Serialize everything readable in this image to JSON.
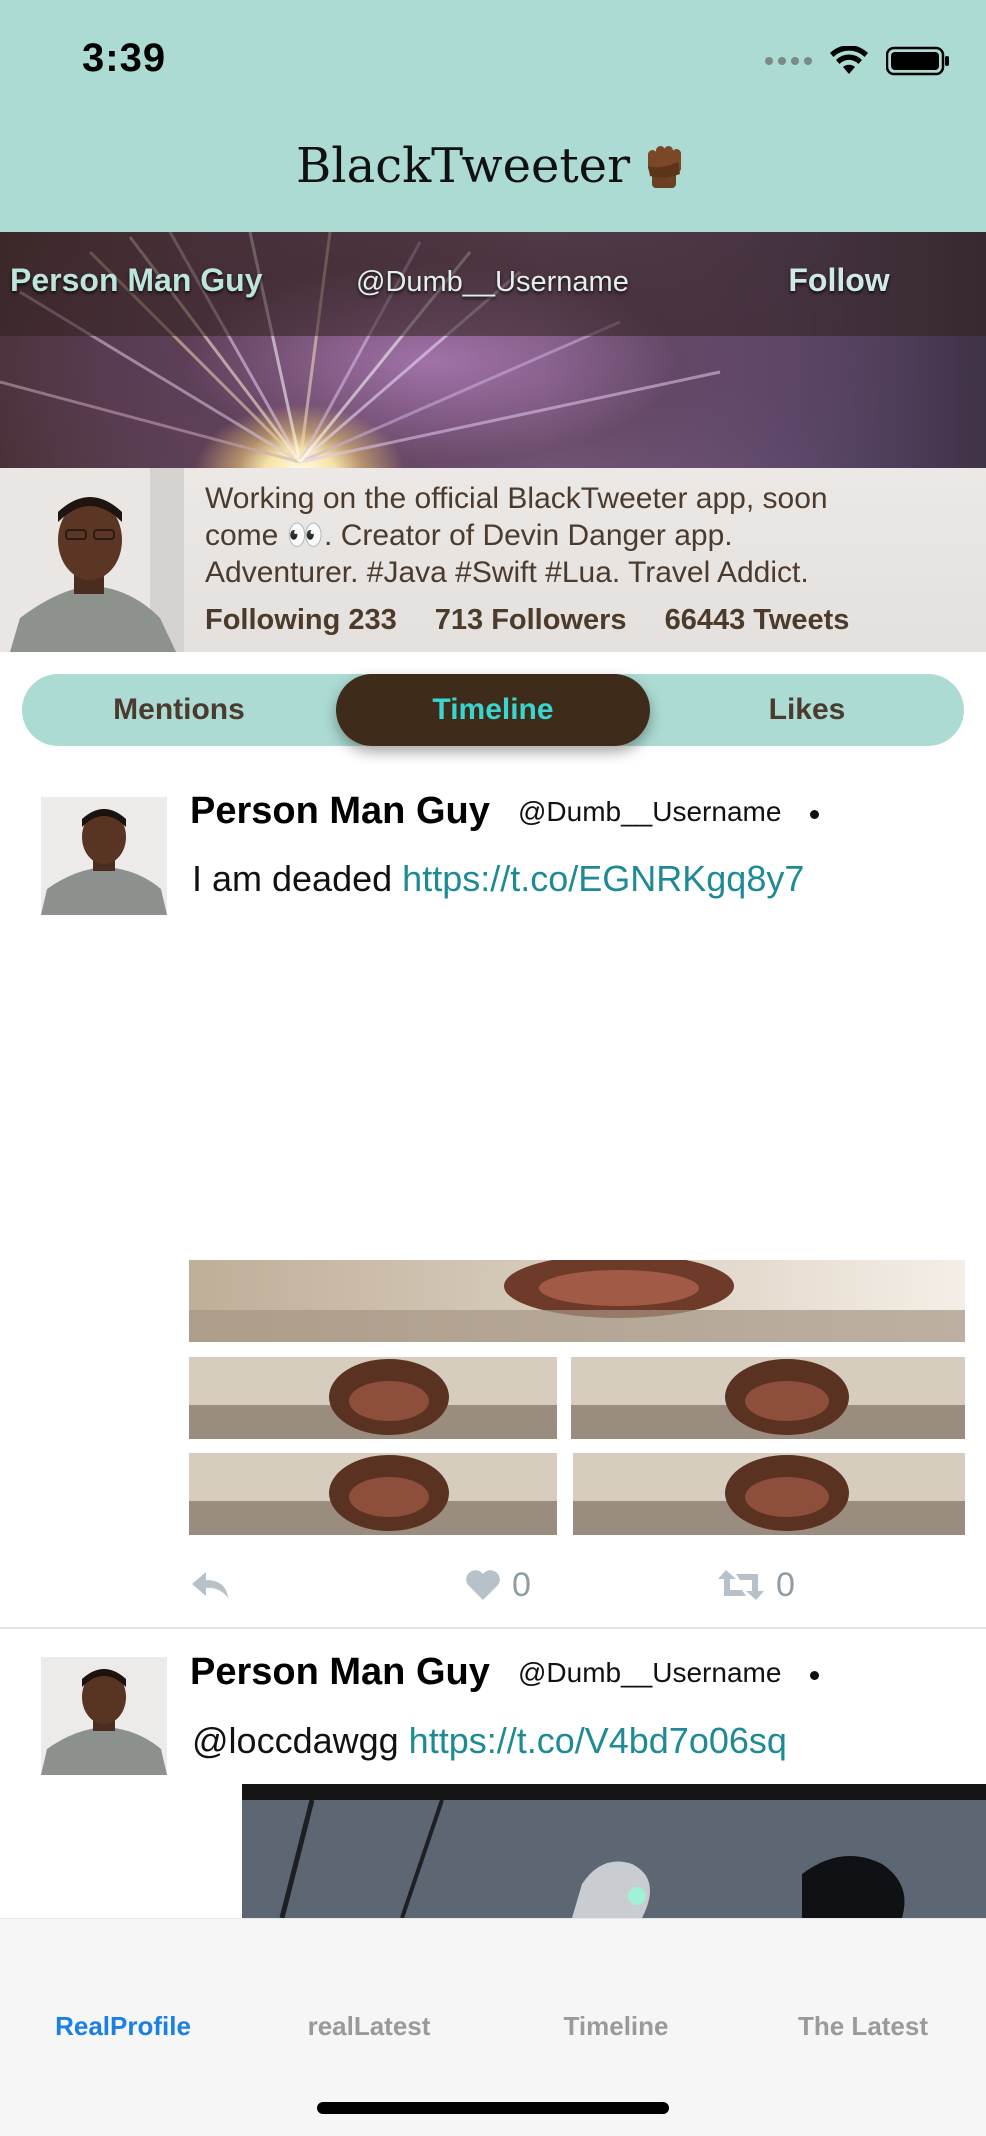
{
  "status_bar": {
    "time": "3:39"
  },
  "nav": {
    "title": "BlackTweeter",
    "title_icon": "raised-fist-emoji"
  },
  "profile": {
    "name": "Person Man Guy",
    "handle": "@Dumb__Username",
    "follow_label": "Follow",
    "bio_lines": [
      "Working on the official BlackTweeter app, soon",
      "come 👀. Creator of Devin Danger app.",
      "Adventurer. #Java #Swift #Lua. Travel Addict."
    ],
    "stats": {
      "following": "Following 233",
      "followers": "713 Followers",
      "tweets": "66443 Tweets"
    }
  },
  "segments": {
    "mentions": "Mentions",
    "timeline": "Timeline",
    "likes": "Likes",
    "selected": "Timeline"
  },
  "tweets": [
    {
      "name": "Person Man Guy",
      "handle": "@Dumb__Username",
      "text": "I am deaded",
      "link": "https://t.co/EGNRKgq8y7",
      "likes": "0",
      "retweets": "0"
    },
    {
      "name": "Person Man Guy",
      "handle": "@Dumb__Username",
      "text": "@loccdawgg",
      "link": "https://t.co/V4bd7o06sq"
    }
  ],
  "tabbar": {
    "items": [
      "RealProfile",
      "realLatest",
      "Timeline",
      "The Latest"
    ],
    "active": "RealProfile"
  },
  "colors": {
    "nav_bg": "#acdbd3",
    "segment_selected_bg": "#3f2b1a",
    "segment_selected_text": "#39d6d0",
    "link": "#1e8a96",
    "tab_active": "#1b7fe3"
  }
}
